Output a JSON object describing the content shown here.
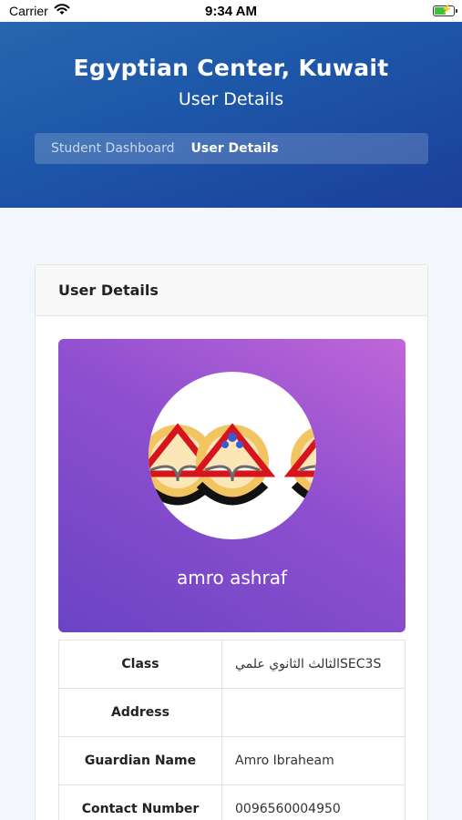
{
  "status_bar": {
    "carrier": "Carrier",
    "time": "9:34 AM",
    "icons": [
      "wifi-icon",
      "battery-charging-icon"
    ]
  },
  "header": {
    "title": "Egyptian Center, Kuwait",
    "subtitle": "User Details",
    "breadcrumb": [
      {
        "label": "Student Dashboard",
        "active": false
      },
      {
        "label": "User Details",
        "active": true
      }
    ]
  },
  "card": {
    "title": "User Details",
    "profile": {
      "name": "amro ashraf",
      "avatar": "school-logo-image"
    },
    "rows": [
      {
        "label": "Class",
        "value": "الثالث الثانوي علميSEC3S"
      },
      {
        "label": "Address",
        "value": ""
      },
      {
        "label": "Guardian Name",
        "value": "Amro Ibraheam"
      },
      {
        "label": "Contact Number",
        "value": "0096560004950"
      }
    ]
  },
  "colors": {
    "header_gradient_start": "#2766b0",
    "header_gradient_end": "#1c3f9a",
    "profile_gradient_start": "#6a44c4",
    "profile_gradient_end": "#c066d8",
    "page_background": "#f3f6fb"
  }
}
